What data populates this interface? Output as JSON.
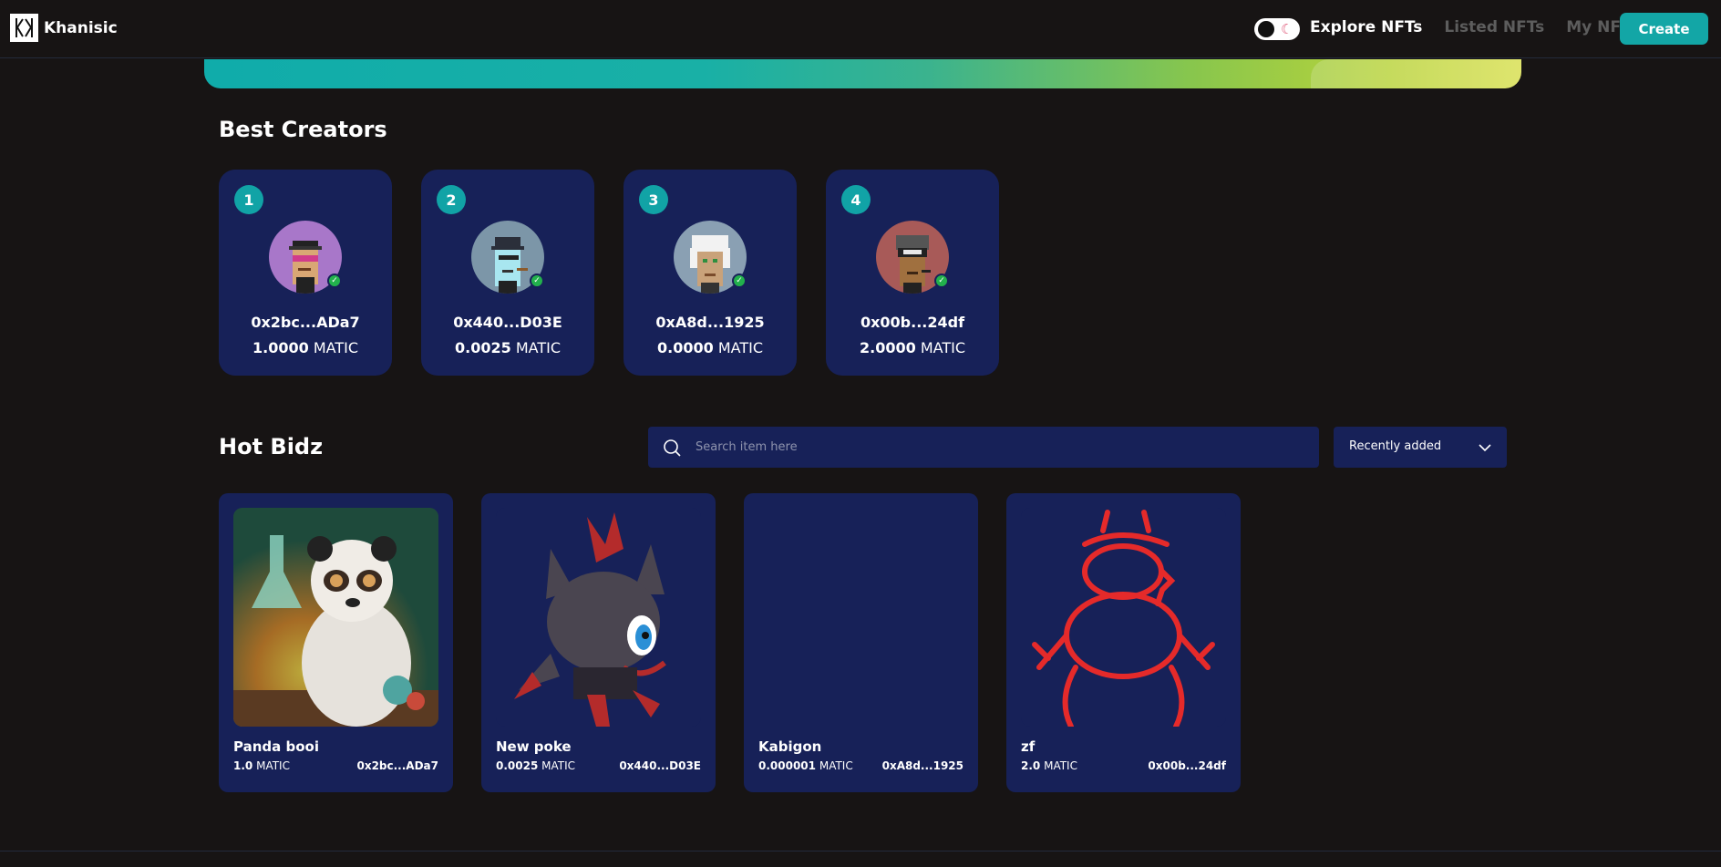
{
  "header": {
    "logo_text": "Khanisic",
    "nav": [
      {
        "label": "Explore NFTs",
        "active": true
      },
      {
        "label": "Listed NFTs",
        "active": false
      },
      {
        "label": "My NFTs",
        "active": false
      }
    ],
    "create_label": "Create",
    "theme_toggle_icons": [
      "sun-dot-icon",
      "moon-icon"
    ]
  },
  "best_creators": {
    "title": "Best Creators",
    "items": [
      {
        "rank": "1",
        "address": "0x2bc...ADa7",
        "amount": "1.0000",
        "unit": "MATIC",
        "avatar_icon": "pixel-punk-avatar-icon",
        "avatar_bg": "#a877c9"
      },
      {
        "rank": "2",
        "address": "0x440...D03E",
        "amount": "0.0025",
        "unit": "MATIC",
        "avatar_icon": "pixel-punk-avatar-icon",
        "avatar_bg": "#7c96a8"
      },
      {
        "rank": "3",
        "address": "0xA8d...1925",
        "amount": "0.0000",
        "unit": "MATIC",
        "avatar_icon": "pixel-punk-avatar-icon",
        "avatar_bg": "#8aa0b3"
      },
      {
        "rank": "4",
        "address": "0x00b...24df",
        "amount": "2.0000",
        "unit": "MATIC",
        "avatar_icon": "pixel-punk-avatar-icon",
        "avatar_bg": "#a85a58"
      }
    ]
  },
  "hot_bidz": {
    "title": "Hot Bidz",
    "search": {
      "placeholder": "Search item here",
      "value": ""
    },
    "sort": {
      "selected": "Recently added"
    },
    "items": [
      {
        "name": "Panda booi",
        "price": "1.0",
        "unit": "MATIC",
        "owner": "0x2bc...ADa7",
        "image_icon": "panda-scientist-image"
      },
      {
        "name": "New poke",
        "price": "0.0025",
        "unit": "MATIC",
        "owner": "0x440...D03E",
        "image_icon": "zorua-image"
      },
      {
        "name": "Kabigon",
        "price": "0.000001",
        "unit": "MATIC",
        "owner": "0xA8d...1925",
        "image_icon": "blank-image"
      },
      {
        "name": "zf",
        "price": "2.0",
        "unit": "MATIC",
        "owner": "0x00b...24df",
        "image_icon": "red-sketch-image"
      }
    ]
  },
  "colors": {
    "background": "#171414",
    "card": "#172158",
    "accent": "#13a6a6",
    "verified": "#22b14c"
  }
}
